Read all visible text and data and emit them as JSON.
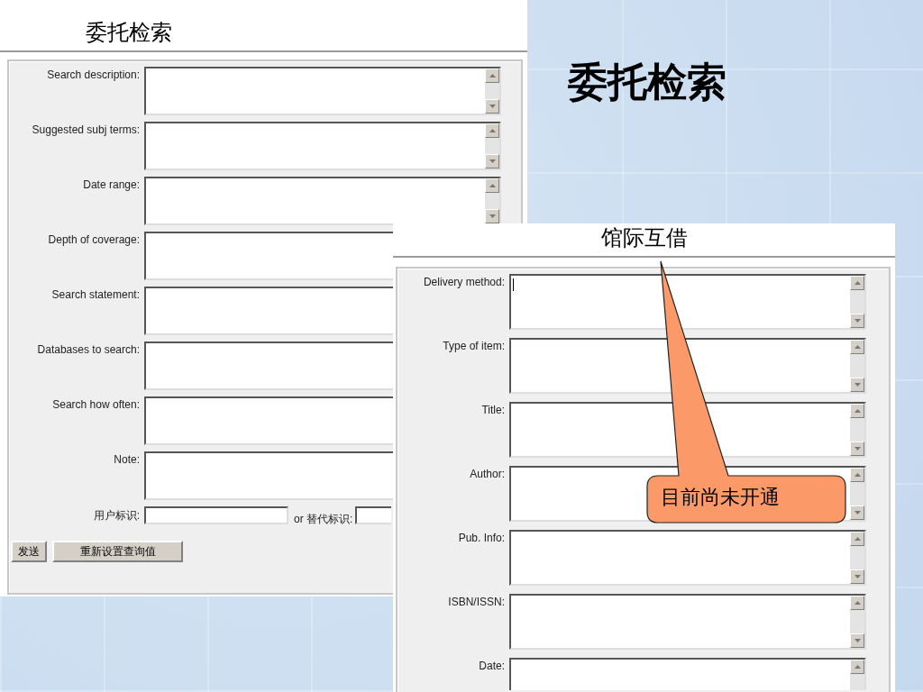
{
  "slide_title": "委托检索",
  "search_form": {
    "title": "委托检索",
    "fields": [
      {
        "label": "Search description:",
        "scrollbar": true,
        "focused": false
      },
      {
        "label": "Suggested subj terms:",
        "scrollbar": true,
        "focused": false
      },
      {
        "label": "Date range:",
        "scrollbar": true,
        "focused": false
      },
      {
        "label": "Depth of coverage:",
        "scrollbar": false,
        "focused": false
      },
      {
        "label": "Search statement:",
        "scrollbar": false,
        "focused": false
      },
      {
        "label": "Databases to search:",
        "scrollbar": false,
        "focused": false
      },
      {
        "label": "Search how often:",
        "scrollbar": false,
        "focused": false
      },
      {
        "label": "Note:",
        "scrollbar": false,
        "focused": false
      }
    ],
    "user_id_label": "用户标识:",
    "alt_id_label": "or 替代标识:",
    "buttons": [
      "发送",
      "重新设置查询值"
    ]
  },
  "ill_form": {
    "title": "馆际互借",
    "fields": [
      {
        "label": "Delivery method:",
        "scrollbar": true,
        "focused": true
      },
      {
        "label": "Type of item:",
        "scrollbar": true,
        "focused": false
      },
      {
        "label": "Title:",
        "scrollbar": true,
        "focused": false
      },
      {
        "label": "Author:",
        "scrollbar": true,
        "focused": false
      },
      {
        "label": "Pub. Info:",
        "scrollbar": true,
        "focused": false
      },
      {
        "label": "ISBN/ISSN:",
        "scrollbar": true,
        "focused": false
      },
      {
        "label": "Date:",
        "scrollbar": true,
        "focused": false,
        "cut_off": true
      }
    ]
  },
  "callout": {
    "text": "目前尚未开通"
  }
}
